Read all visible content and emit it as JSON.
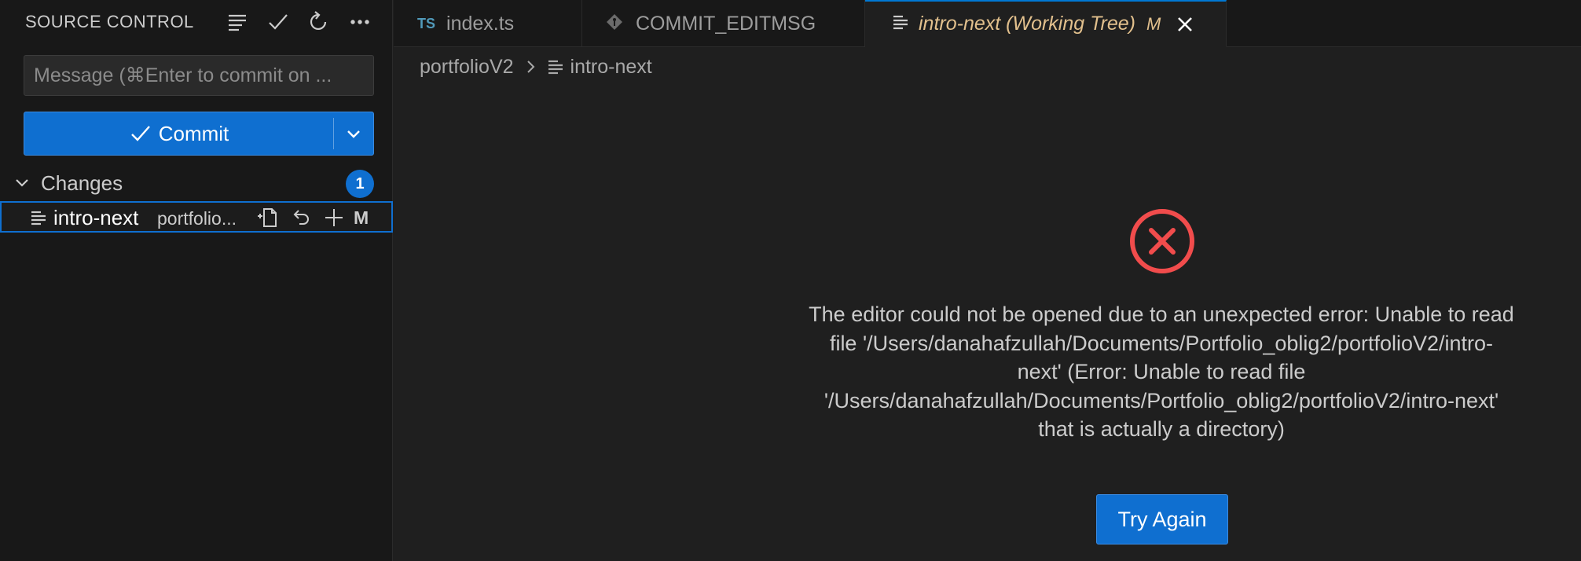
{
  "sidebar": {
    "title": "SOURCE CONTROL",
    "actions": [
      "view-as-tree-icon",
      "commit-check-icon",
      "refresh-icon",
      "more-actions-icon"
    ],
    "message_placeholder": "Message (⌘Enter to commit on ...",
    "commit_label": "Commit",
    "changes": {
      "label": "Changes",
      "count": "1",
      "files": [
        {
          "name": "intro-next",
          "path": "portfolio...",
          "status": "M"
        }
      ]
    }
  },
  "tabs": [
    {
      "label": "index.ts",
      "badge": "TS"
    },
    {
      "label": "COMMIT_EDITMSG"
    },
    {
      "label": "intro-next (Working Tree)",
      "status": "M"
    }
  ],
  "breadcrumb": {
    "folder": "portfolioV2",
    "file": "intro-next"
  },
  "error": {
    "message": "The editor could not be opened due to an unexpected error: Unable to read file '/Users/danahafzullah/Documents/Portfolio_oblig2/portfolioV2/intro-next' (Error: Unable to read file '/Users/danahafzullah/Documents/Portfolio_oblig2/portfolioV2/intro-next' that is actually a directory)",
    "retry_label": "Try Again"
  },
  "colors": {
    "accent": "#0f6fd0",
    "modified": "#e2c08d",
    "error": "#f14c4c",
    "ts": "#519aba"
  }
}
